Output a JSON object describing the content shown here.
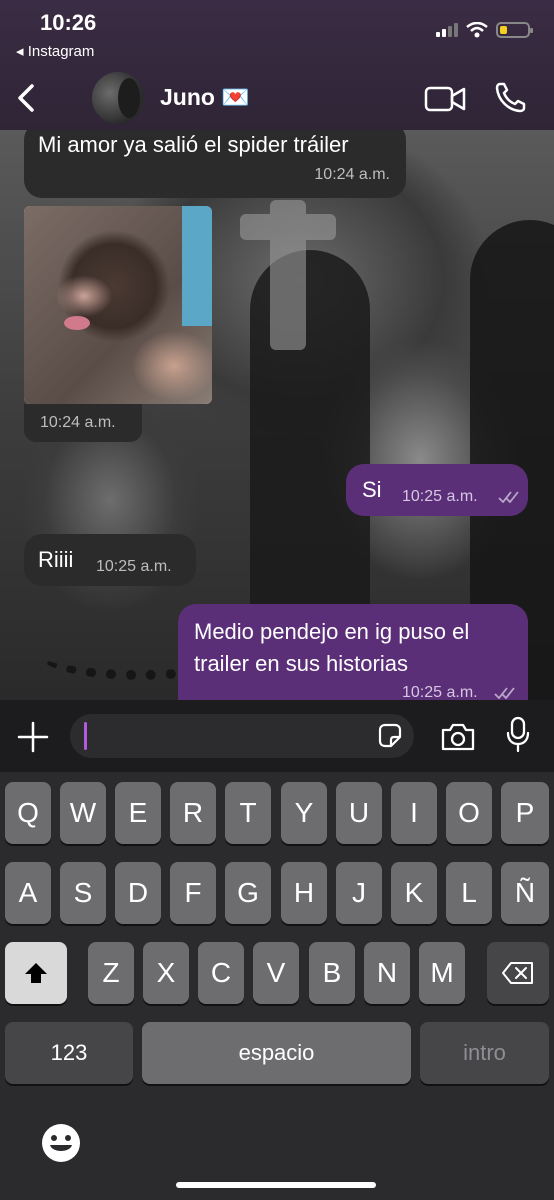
{
  "status": {
    "time": "10:26",
    "back_app": "◂ Instagram"
  },
  "header": {
    "contact_name": "Juno 💌"
  },
  "messages": [
    {
      "dir": "in",
      "text": "Mi amor ya salió el spider tráiler",
      "time": "10:24 a.m."
    },
    {
      "dir": "in",
      "type": "photo",
      "time": "10:24 a.m."
    },
    {
      "dir": "out",
      "text": "Si",
      "time": "10:25 a.m.",
      "status": "read"
    },
    {
      "dir": "in",
      "text": "Riiii",
      "time": "10:25 a.m."
    },
    {
      "dir": "out",
      "text": "Medio pendejo en ig puso el trailer en sus historias",
      "time": "10:25 a.m.",
      "status": "read"
    }
  ],
  "composer": {
    "value": ""
  },
  "keyboard": {
    "row1": [
      "Q",
      "W",
      "E",
      "R",
      "T",
      "Y",
      "U",
      "I",
      "O",
      "P"
    ],
    "row2": [
      "A",
      "S",
      "D",
      "F",
      "G",
      "H",
      "J",
      "K",
      "L",
      "Ñ"
    ],
    "row3": [
      "Z",
      "X",
      "C",
      "V",
      "B",
      "N",
      "M"
    ],
    "numbers_label": "123",
    "space_label": "espacio",
    "return_label": "intro"
  },
  "colors": {
    "outgoing_bubble": "#5a2f78",
    "incoming_bubble": "#2b2b2b",
    "cursor": "#b35ae0",
    "header_bg": "#3a2c44"
  },
  "icons": [
    "back-chevron-icon",
    "video-call-icon",
    "phone-icon",
    "plus-icon",
    "sticker-icon",
    "camera-icon",
    "mic-icon",
    "shift-icon",
    "backspace-icon",
    "emoji-icon",
    "read-ticks-icon"
  ]
}
